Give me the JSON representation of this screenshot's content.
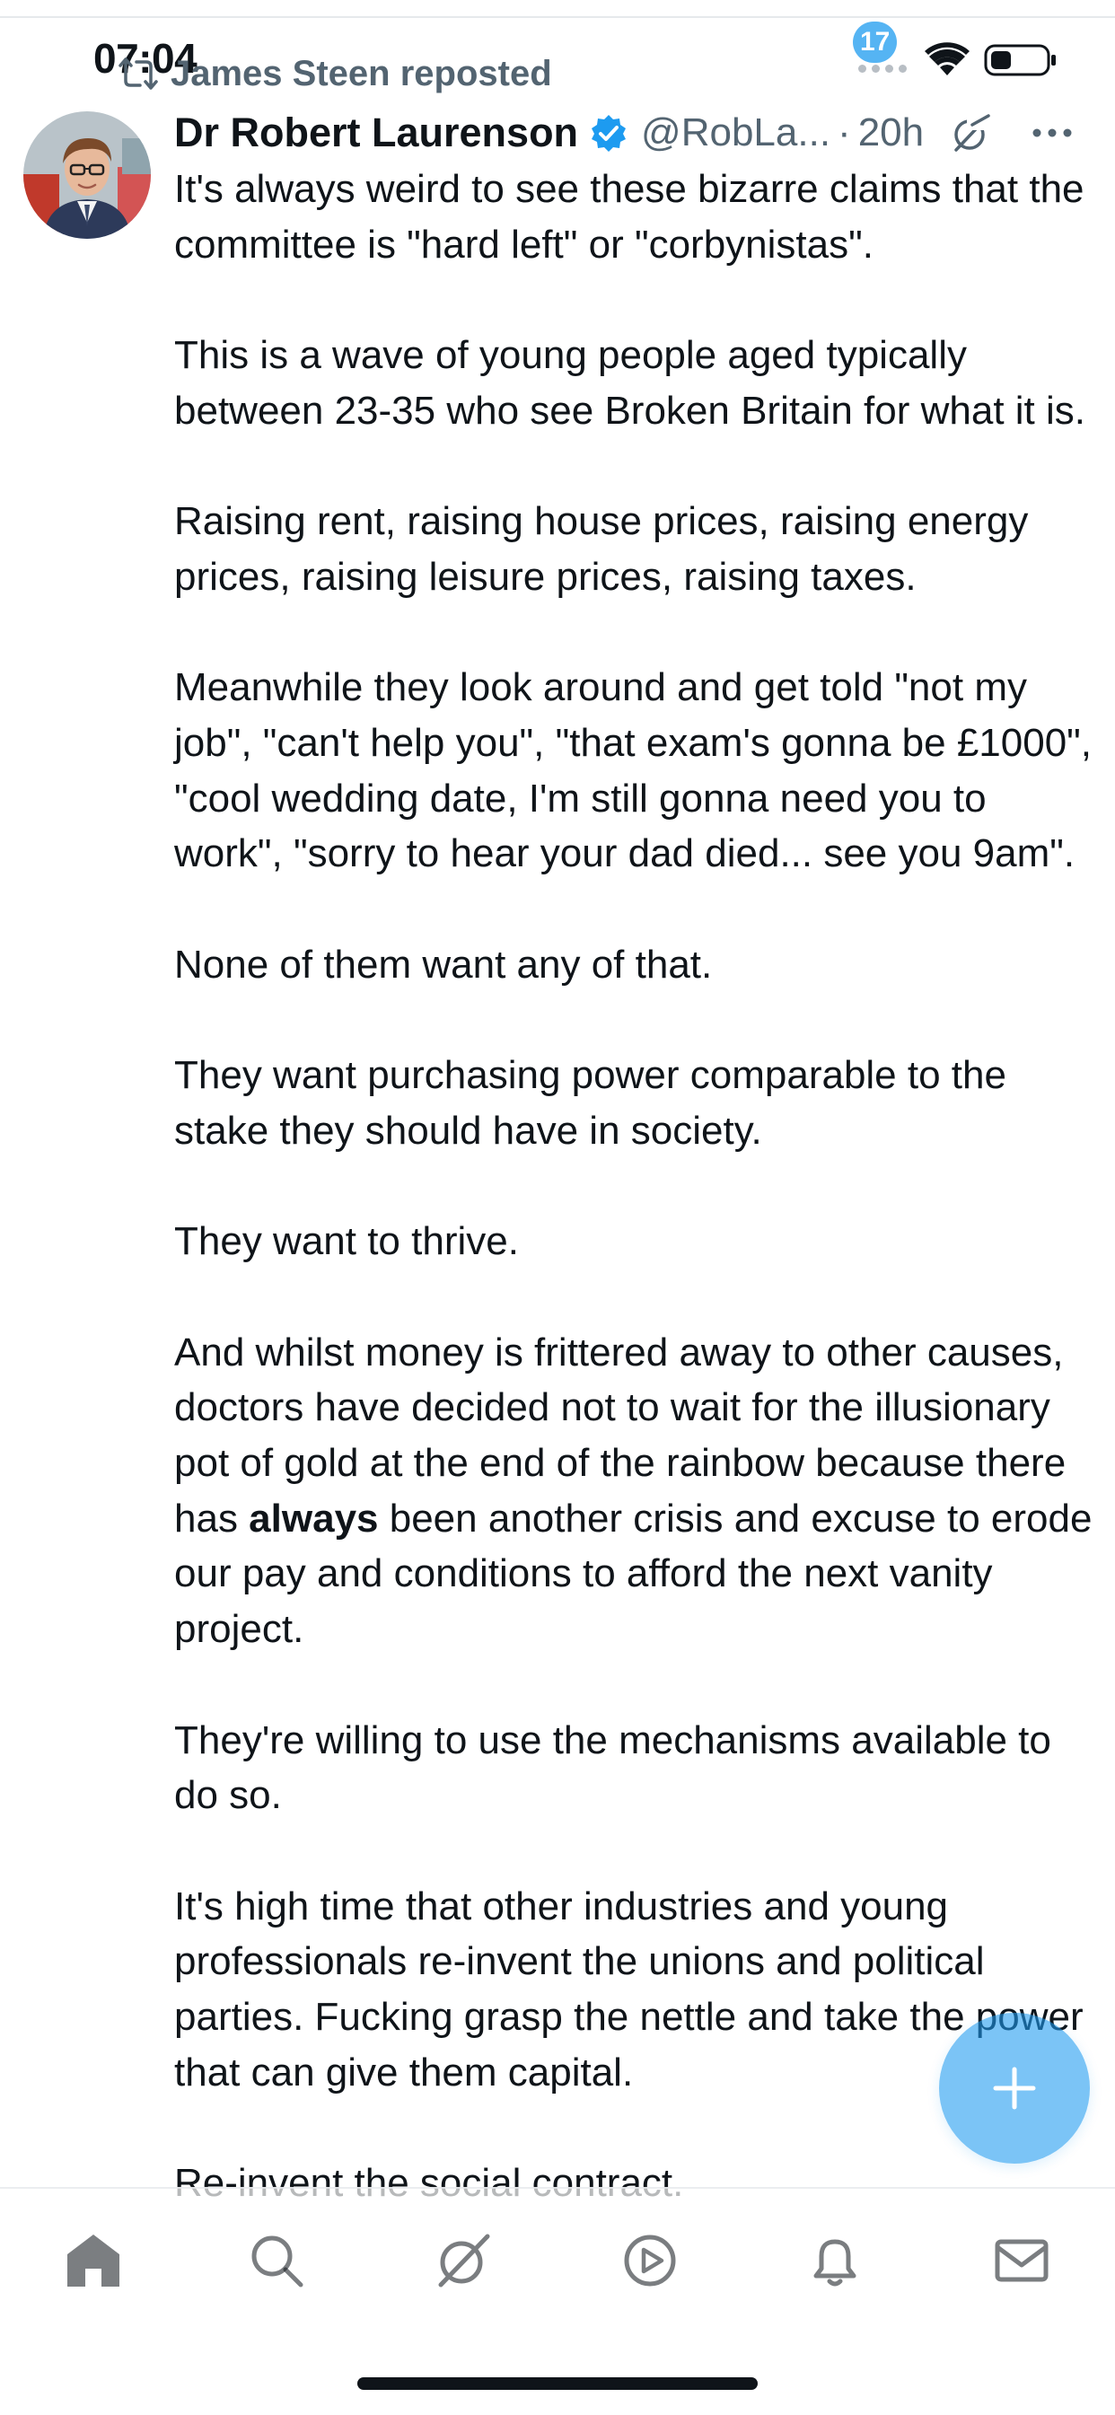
{
  "status_bar": {
    "time": "07:04"
  },
  "repost": {
    "label": "James Steen reposted",
    "icon": "repost-icon"
  },
  "tweet": {
    "author_name": "Dr Robert Laurenson",
    "verified": true,
    "handle": "@RobLa...",
    "separator": "·",
    "time_ago": "20h",
    "paragraphs": [
      "It's always weird to see these bizarre claims that the committee is \"hard left\" or \"corbynistas\".",
      "This is a wave of young people aged typically between 23-35 who see Broken Britain for what it is.",
      "Raising rent, raising house prices, raising energy prices, raising leisure prices, raising taxes.",
      "Meanwhile they look around and get told \"not my job\", \"can't help you\", \"that exam's gonna be £1000\", \"cool wedding date, I'm still gonna need you to work\", \"sorry to hear your dad died... see you 9am\".",
      "None of them want any of that.",
      "They want purchasing power comparable to the stake they should have in society.",
      "They want to thrive.",
      {
        "before": "And whilst money is frittered away to other causes, doctors have decided not to wait for the illusionary pot of gold at the end of the rainbow because there has ",
        "bold": "always",
        "after": " been another crisis and excuse to erode our pay and conditions to afford the next vanity project."
      },
      "They're willing to use the mechanisms available to do so.",
      "It's high time that other industries and young professionals re-invent the unions and political parties. Fucking grasp the nettle and take the power that can give them capital.",
      "Re-invent the social contract."
    ]
  },
  "fab": {
    "icon": "plus-icon"
  },
  "tab_bar": {
    "items": [
      {
        "name": "home",
        "icon": "home-icon"
      },
      {
        "name": "search",
        "icon": "search-icon"
      },
      {
        "name": "grok",
        "icon": "grok-icon"
      },
      {
        "name": "video",
        "icon": "play-icon"
      },
      {
        "name": "notifications",
        "icon": "bell-icon"
      },
      {
        "name": "messages",
        "icon": "mail-icon"
      }
    ],
    "notification_count": "17"
  },
  "colors": {
    "text": "#0f1419",
    "secondary": "#536471",
    "accent": "#1d9bf0"
  }
}
